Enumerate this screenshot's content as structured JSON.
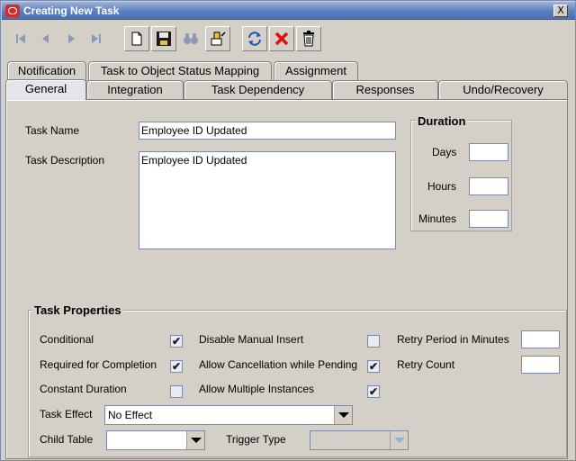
{
  "window": {
    "title": "Creating New Task",
    "close_glyph": "X"
  },
  "toolbar": {
    "buttons": [
      {
        "name": "first-record",
        "icon": "first-icon"
      },
      {
        "name": "previous-record",
        "icon": "previous-icon"
      },
      {
        "name": "next-record",
        "icon": "next-icon"
      },
      {
        "name": "last-record",
        "icon": "last-icon"
      },
      {
        "name": "new",
        "icon": "new-document-icon"
      },
      {
        "name": "save",
        "icon": "save-icon"
      },
      {
        "name": "find",
        "icon": "binoculars-icon"
      },
      {
        "name": "edit",
        "icon": "edit-icon"
      },
      {
        "name": "refresh",
        "icon": "refresh-icon"
      },
      {
        "name": "cancel",
        "icon": "red-x-icon"
      },
      {
        "name": "delete",
        "icon": "trash-icon"
      }
    ]
  },
  "tabs": {
    "top": [
      "Notification",
      "Task to Object Status Mapping",
      "Assignment"
    ],
    "bottom": [
      "General",
      "Integration",
      "Task Dependency",
      "Responses",
      "Undo/Recovery"
    ],
    "selected": "General"
  },
  "general": {
    "task_name_label": "Task Name",
    "task_name_value": "Employee ID Updated",
    "task_description_label": "Task Description",
    "task_description_value": "Employee ID Updated"
  },
  "duration": {
    "title": "Duration",
    "days_label": "Days",
    "hours_label": "Hours",
    "minutes_label": "Minutes",
    "days_value": "",
    "hours_value": "",
    "minutes_value": ""
  },
  "task_properties": {
    "title": "Task Properties",
    "conditional_label": "Conditional",
    "conditional_checked": true,
    "required_label": "Required for Completion",
    "required_checked": true,
    "constant_duration_label": "Constant Duration",
    "constant_duration_checked": false,
    "disable_manual_insert_label": "Disable Manual Insert",
    "disable_manual_insert_checked": false,
    "allow_cancellation_label": "Allow Cancellation while Pending",
    "allow_cancellation_checked": true,
    "allow_multiple_label": "Allow Multiple Instances",
    "allow_multiple_checked": true,
    "retry_period_label": "Retry Period in Minutes",
    "retry_period_value": "",
    "retry_count_label": "Retry Count",
    "retry_count_value": "",
    "task_effect_label": "Task Effect",
    "task_effect_value": "No Effect",
    "child_table_label": "Child Table",
    "child_table_value": "",
    "trigger_type_label": "Trigger Type",
    "trigger_type_value": "",
    "check_glyph": "✔"
  }
}
